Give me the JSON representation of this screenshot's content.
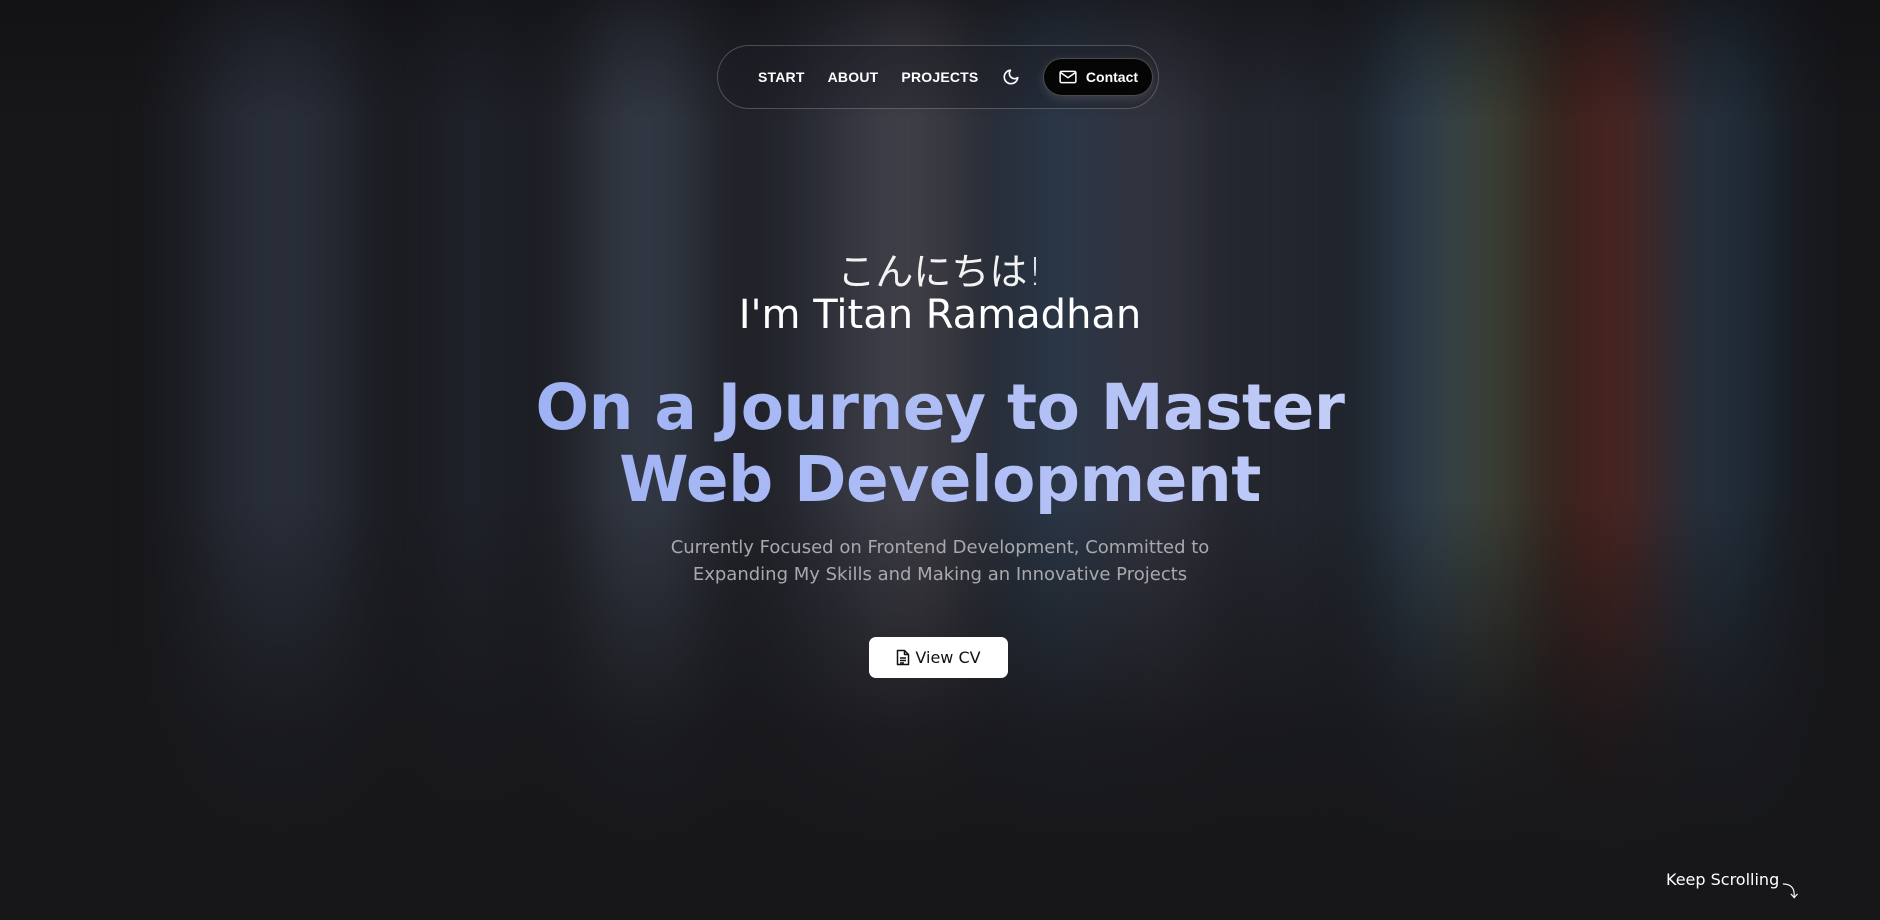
{
  "nav": {
    "links": [
      "START",
      "ABOUT",
      "PROJECTS"
    ],
    "theme_icon": "moon-icon",
    "contact_icon": "mail-icon",
    "contact_label": "Contact"
  },
  "hero": {
    "greeting": "こんにちは!",
    "intro": "I'm Titan Ramadhan",
    "headline_line1": "On a Journey to Master",
    "headline_line2": "Web Development",
    "subtext_line1": "Currently Focused on Frontend Development, Committed to",
    "subtext_line2": "Expanding My Skills and Making an Innovative Projects",
    "cv_icon": "document-icon",
    "cv_label": "View CV"
  },
  "footer": {
    "scroll_label": "Keep Scrolling",
    "scroll_icon": "arrow-down-curve-icon"
  },
  "colors": {
    "background": "#17171a",
    "headline_gradient_start": "#a6c1f5",
    "headline_gradient_end": "#dfe4fb",
    "subtext": "#a9a9ad",
    "button_bg": "#ffffff"
  }
}
